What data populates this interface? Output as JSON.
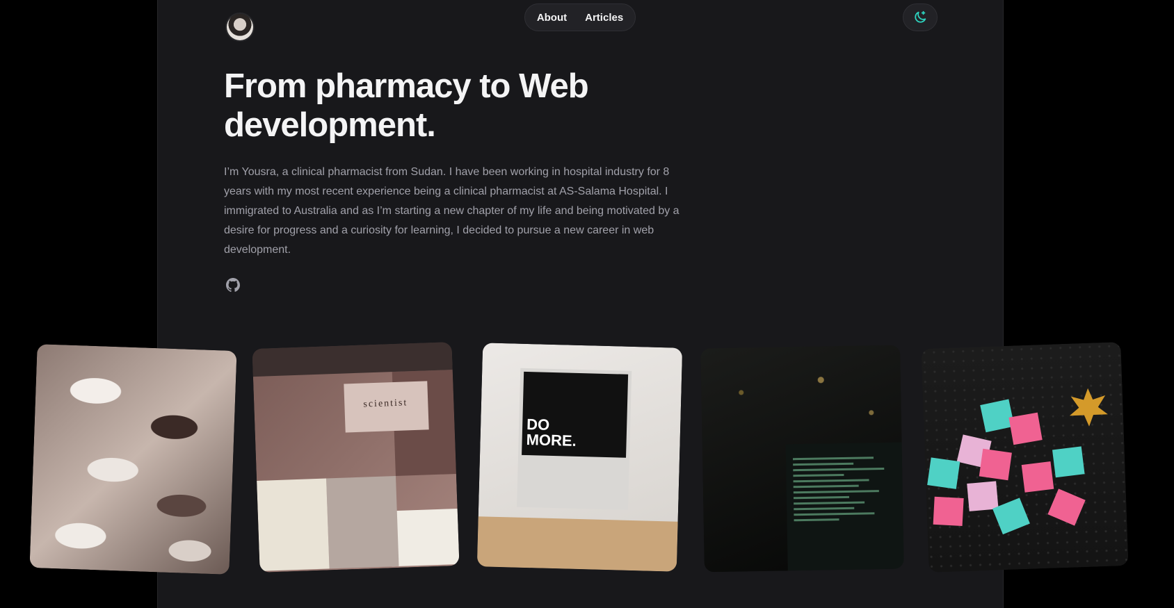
{
  "nav": {
    "about": "About",
    "articles": "Articles"
  },
  "hero": {
    "title": "From pharmacy to Web development.",
    "bio": "I’m Yousra, a clinical pharmacist from Sudan. I have been working in hospital industry for 8 years with my most recent experience being a clinical pharmacist at AS-Salama Hospital. I immigrated to Australia and as I’m starting a new chapter of my life and being motivated by a desire for progress and a curiosity for learning, I decided to pursue a new career in web development."
  },
  "photos": {
    "collage_label": "scientist",
    "screen_text_line1": "DO",
    "screen_text_line2": "MORE."
  },
  "colors": {
    "background": "#000000",
    "panel": "#18181b",
    "text": "#f4f4f5",
    "muted": "#a1a1aa",
    "accent": "#2dd4bf"
  },
  "icons": {
    "theme_toggle": "moon-icon",
    "social": "github-icon"
  }
}
